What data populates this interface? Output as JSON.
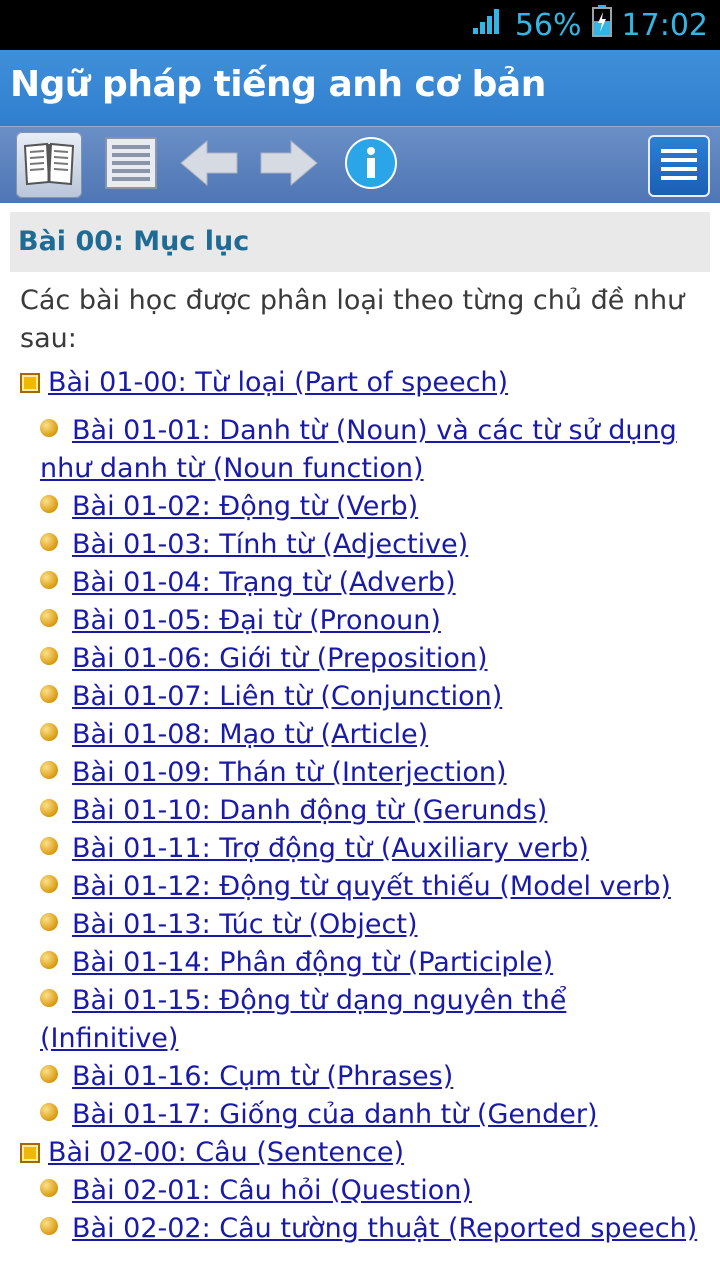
{
  "status": {
    "battery": "56%",
    "time": "17:02",
    "signal_icon": "signal-icon",
    "battery_icon": "battery-charging-icon"
  },
  "app": {
    "title": "Ngữ pháp tiếng anh cơ bản"
  },
  "toolbar": {
    "icons": [
      "book-icon",
      "list-icon",
      "arrow-left-icon",
      "arrow-right-icon",
      "info-icon",
      "menu-icon"
    ]
  },
  "lesson": {
    "title": "Bài 00: Mục lục",
    "intro": "Các bài học được phân loại theo từng chủ đề như sau:"
  },
  "sections": [
    {
      "title": "Bài 01-00: Từ loại (Part of speech)",
      "items": [
        "Bài 01-01: Danh từ (Noun) và các từ sử dụng như danh từ (Noun function)",
        "Bài 01-02: Động từ (Verb)",
        "Bài 01-03: Tính từ (Adjective)",
        "Bài 01-04: Trạng từ (Adverb)",
        "Bài 01-05: Đại từ (Pronoun)",
        "Bài 01-06: Giới từ (Preposition)",
        "Bài 01-07: Liên từ (Conjunction)",
        "Bài 01-08: Mạo từ (Article)",
        "Bài 01-09: Thán từ (Interjection)",
        "Bài 01-10: Danh động từ (Gerunds)",
        "Bài 01-11: Trợ động từ (Auxiliary verb)",
        "Bài 01-12: Động từ quyết thiếu (Model verb)",
        "Bài 01-13: Túc từ (Object)",
        "Bài 01-14: Phân động từ (Participle)",
        "Bài 01-15: Động từ dạng nguyên thể (Infinitive)",
        "Bài 01-16: Cụm từ (Phrases)",
        "Bài 01-17: Giống của danh từ (Gender)"
      ]
    },
    {
      "title": "Bài 02-00: Câu (Sentence)",
      "items": [
        "Bài 02-01: Câu hỏi (Question)",
        "Bài 02-02: Câu tường thuật (Reported speech)"
      ]
    }
  ],
  "colors": {
    "title_bar": "#2f7fd0",
    "toolbar": "#5a80bd",
    "link": "#1a1aa8",
    "lesson_title": "#1f6b95"
  }
}
